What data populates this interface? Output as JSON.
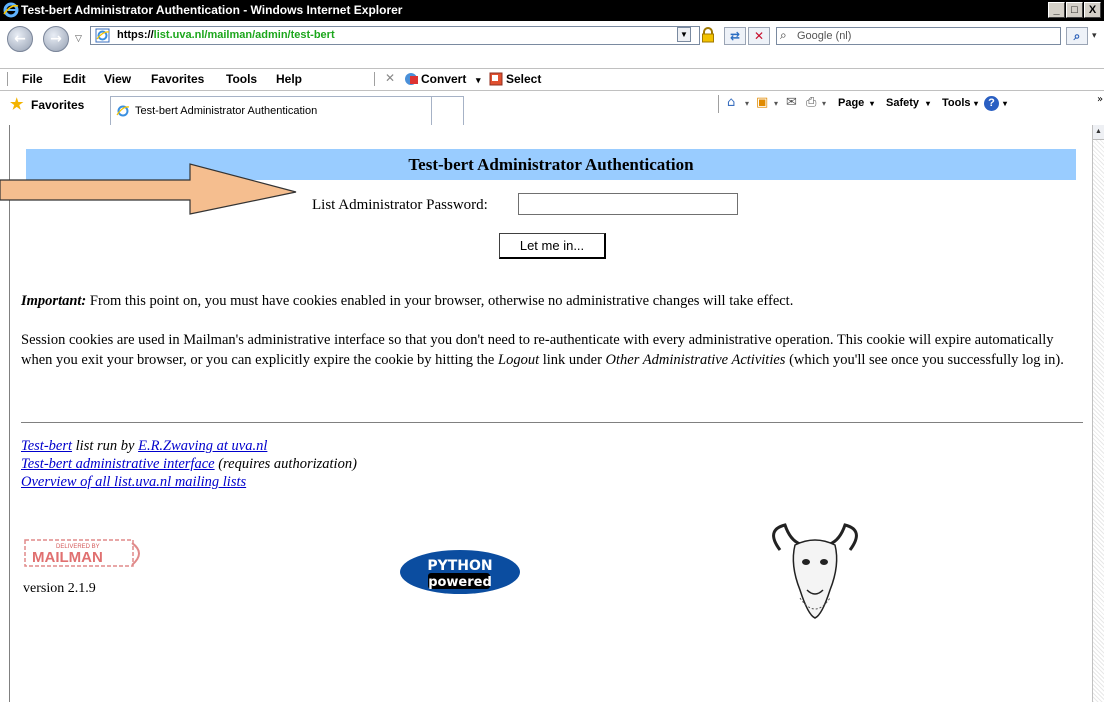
{
  "window": {
    "title": "Test-bert Administrator Authentication - Windows Internet Explorer",
    "buttons": [
      "_",
      "□",
      "X"
    ]
  },
  "address": {
    "proto": "https://",
    "host": "list.uva.nl",
    "path": "/mailman/admin/test-bert"
  },
  "search": {
    "placeholder": "Google (nl)"
  },
  "menu": {
    "items": [
      "File",
      "Edit",
      "View",
      "Favorites",
      "Tools",
      "Help"
    ],
    "convert_label": "Convert",
    "select_label": "Select"
  },
  "favorites": {
    "label": "Favorites",
    "tab_title": "Test-bert Administrator Authentication",
    "page_label": "Page",
    "safety_label": "Safety",
    "tools_label": "Tools"
  },
  "page": {
    "banner": "Test-bert Administrator Authentication",
    "password_label": "List Administrator Password:",
    "password_value": "",
    "login_button": "Let me in...",
    "important_label": "Important:",
    "important_text": " From this point on, you must have cookies enabled in your browser, otherwise no administrative changes will take effect.",
    "session_text_1": "Session cookies are used in Mailman's administrative interface so that you don't need to re-authenticate with every administrative operation. This cookie will expire automatically when you exit your browser, or you can explicitly expire the cookie by hitting the ",
    "logout_word": "Logout",
    "session_text_2": " link under ",
    "other_activities": "Other Administrative Activities",
    "session_text_3": " (which you'll see once you successfully log in).",
    "footer": {
      "list_link": "Test-bert",
      "run_by": " list run by ",
      "owner_link": "E.R.Zwaving at uva.nl",
      "admin_link": "Test-bert administrative interface",
      "admin_note": " (requires authorization)",
      "overview_link": "Overview of all list.uva.nl mailing lists"
    },
    "mailman_logo_text": "MAILMAN",
    "mailman_logo_small": "DELIVERED BY",
    "version": "version 2.1.9",
    "python_logo_top": "PYTHON",
    "python_logo_bottom": "powered"
  },
  "colors": {
    "banner": "#99ccff",
    "link": "#0000cc",
    "url_green": "#1ca61c"
  }
}
